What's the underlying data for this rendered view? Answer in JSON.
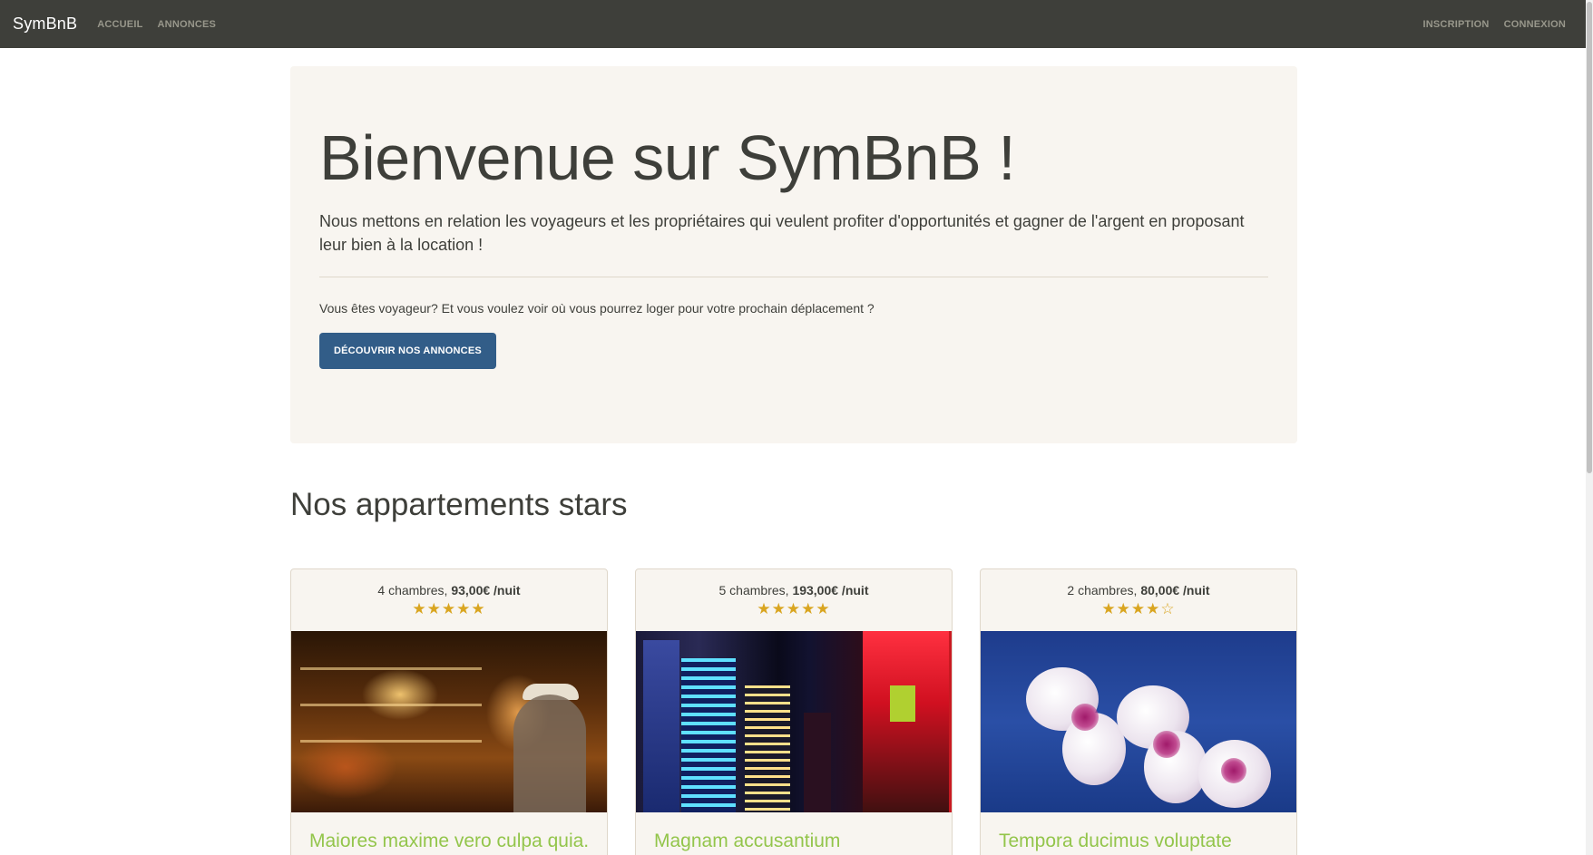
{
  "navbar": {
    "brand": "SymBnB",
    "links_left": [
      "ACCUEIL",
      "ANNONCES"
    ],
    "links_right": [
      "INSCRIPTION",
      "CONNEXION"
    ]
  },
  "jumbotron": {
    "title": "Bienvenue sur SymBnB !",
    "lead": "Nous mettons en relation les voyageurs et les propriétaires qui veulent profiter d'opportunités et gagner de l'argent en proposant leur bien à la location !",
    "text": "Vous êtes voyageur? Et vous voulez voir où vous pourrez loger pour votre prochain déplacement ?",
    "button_label": "DÉCOUVRIR NOS ANNONCES"
  },
  "section_title": "Nos appartements stars",
  "colors": {
    "navbar": "#3e3f3a",
    "primary": "#325d88",
    "success": "#93c54b",
    "star": "#d9a520",
    "panel_bg": "#f8f5f0"
  },
  "cards": [
    {
      "rooms": "4 chambres,",
      "price": "93,00€ /nuit",
      "rating": 5,
      "rating_max": 5,
      "image": "bar-interior-photo",
      "title": "Maiores maxime vero culpa quia."
    },
    {
      "rooms": "5 chambres,",
      "price": "193,00€ /nuit",
      "rating": 5,
      "rating_max": 5,
      "image": "city-night-photo",
      "title": "Magnam accusantium"
    },
    {
      "rooms": "2 chambres,",
      "price": "80,00€ /nuit",
      "rating": 4,
      "rating_max": 5,
      "image": "orchid-photo",
      "title": "Tempora ducimus voluptate"
    }
  ]
}
